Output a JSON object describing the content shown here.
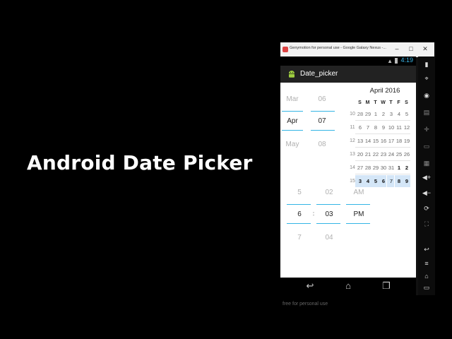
{
  "headline": "Android Date Picker",
  "window": {
    "title": "Genymotion for personal use - Google Galaxy Nexus -...",
    "minimize": "–",
    "maximize": "□",
    "close": "✕"
  },
  "status_bar": {
    "time": "4:19",
    "wifi_icon": "wifi-icon",
    "battery_icon": "battery-icon"
  },
  "app_bar": {
    "title": "Date_picker",
    "icon": "android-icon"
  },
  "date_spinner": {
    "month": {
      "prev": "Mar",
      "current": "Apr",
      "next": "May"
    },
    "day": {
      "prev": "06",
      "current": "07",
      "next": "08"
    }
  },
  "calendar": {
    "title": "April 2016",
    "weekday_headers": [
      "S",
      "M",
      "T",
      "W",
      "T",
      "F",
      "S"
    ],
    "week_numbers": [
      "10",
      "11",
      "12",
      "13",
      "14",
      "15"
    ],
    "weeks": [
      [
        "28",
        "29",
        "1",
        "2",
        "3",
        "4",
        "5"
      ],
      [
        "6",
        "7",
        "8",
        "9",
        "10",
        "11",
        "12"
      ],
      [
        "13",
        "14",
        "15",
        "16",
        "17",
        "18",
        "19"
      ],
      [
        "20",
        "21",
        "22",
        "23",
        "24",
        "25",
        "26"
      ],
      [
        "27",
        "28",
        "29",
        "30",
        "31",
        "1",
        "2"
      ],
      [
        "3",
        "4",
        "5",
        "6",
        "7",
        "8",
        "9"
      ]
    ],
    "selected_day": "7",
    "highlight_color": "#d4e6f7"
  },
  "time_spinner": {
    "hour": {
      "prev": "5",
      "current": "6",
      "next": "7"
    },
    "separator": ":",
    "minute": {
      "prev": "02",
      "current": "03",
      "next": "04"
    },
    "ampm": {
      "prev": "AM",
      "current": "PM"
    }
  },
  "nav_bar": {
    "back": "back-icon",
    "home": "home-icon",
    "recents": "recents-icon"
  },
  "watermark": "free for personal use",
  "side_toolbar": [
    "battery-icon",
    "gps-icon",
    "camera-icon",
    "remote-control-icon",
    "dpad-icon",
    "id-icon",
    "media-icon",
    "volume-up-icon",
    "volume-down-icon",
    "rotate-icon",
    "fullscreen-icon",
    "back-icon",
    "menu-icon",
    "home-icon",
    "recents-icon",
    "power-icon"
  ],
  "colors": {
    "accent": "#33b5e5",
    "status_time": "#3bb7e8"
  }
}
